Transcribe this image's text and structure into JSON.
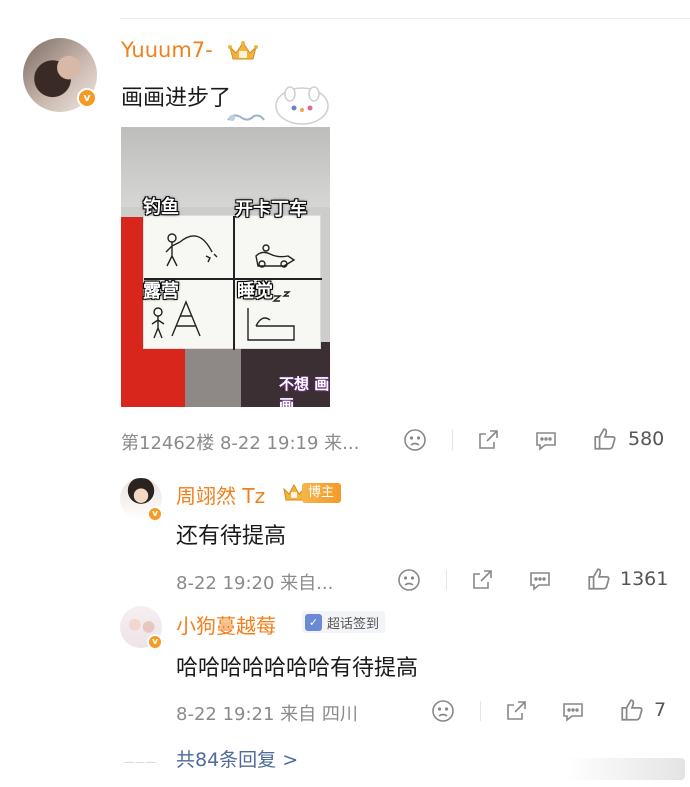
{
  "main_comment": {
    "username": "Yuuum7-",
    "text": "画画进步了",
    "meta": "第12462楼 8-22 19:19 来...",
    "likes": "580",
    "image_labels": [
      "钓鱼",
      "开卡丁车",
      "露营",
      "睡觉"
    ],
    "image_watermark": "不想 画画"
  },
  "replies": [
    {
      "username": "周翊然 Tz",
      "badge_label": "博主",
      "text": "还有待提高",
      "meta": "8-22 19:20 来自...",
      "likes": "1361"
    },
    {
      "username": "小狗蔓越莓",
      "badge_label": "超话签到",
      "text": "哈哈哈哈哈哈哈有待提高",
      "meta": "8-22 19:21 来自 四川",
      "likes": "7"
    }
  ],
  "more_replies_label": "共84条回复 >",
  "colors": {
    "username": "#f27f1b",
    "meta": "#8a8a8a",
    "link": "#516a9a",
    "badge": "#f59a23"
  },
  "icons": [
    "verified-badge-icon",
    "crown-icon",
    "dislike-face-icon",
    "share-icon",
    "comment-icon",
    "like-thumb-icon",
    "super-topic-checkin-icon"
  ]
}
